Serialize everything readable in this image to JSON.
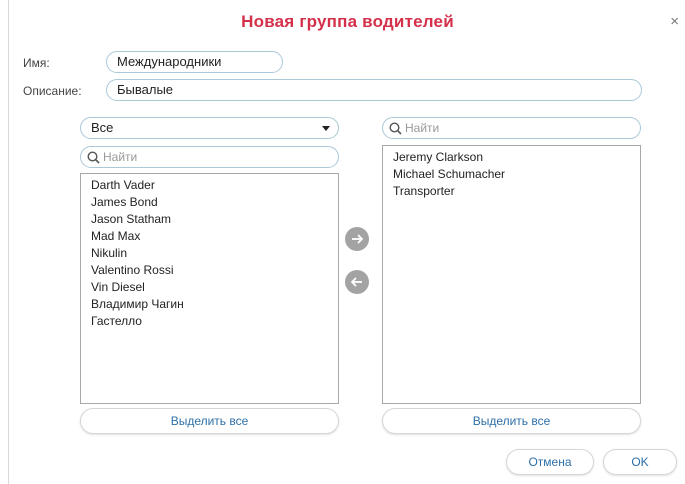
{
  "dialog": {
    "title": "Новая группа водителей",
    "close_label": "×"
  },
  "form": {
    "name_label": "Имя:",
    "name_value": "Международники",
    "description_label": "Описание:",
    "description_value": "Бывалые"
  },
  "left_panel": {
    "filter_selected": "Все",
    "search_placeholder": "Найти",
    "items": [
      "Darth Vader",
      "James Bond",
      "Jason Statham",
      "Mad Max",
      "Nikulin",
      "Valentino Rossi",
      "Vin Diesel",
      "Владимир Чагин",
      "Гастелло"
    ],
    "select_all_label": "Выделить все"
  },
  "right_panel": {
    "search_placeholder": "Найти",
    "items": [
      "Jeremy Clarkson",
      "Michael Schumacher",
      "Transporter"
    ],
    "select_all_label": "Выделить все"
  },
  "footer": {
    "cancel_label": "Отмена",
    "ok_label": "OK"
  },
  "colors": {
    "title": "#d4304a",
    "link_text": "#2d6fa8",
    "arrow_button": "#a3a3a3",
    "field_border": "#aac8d8"
  }
}
